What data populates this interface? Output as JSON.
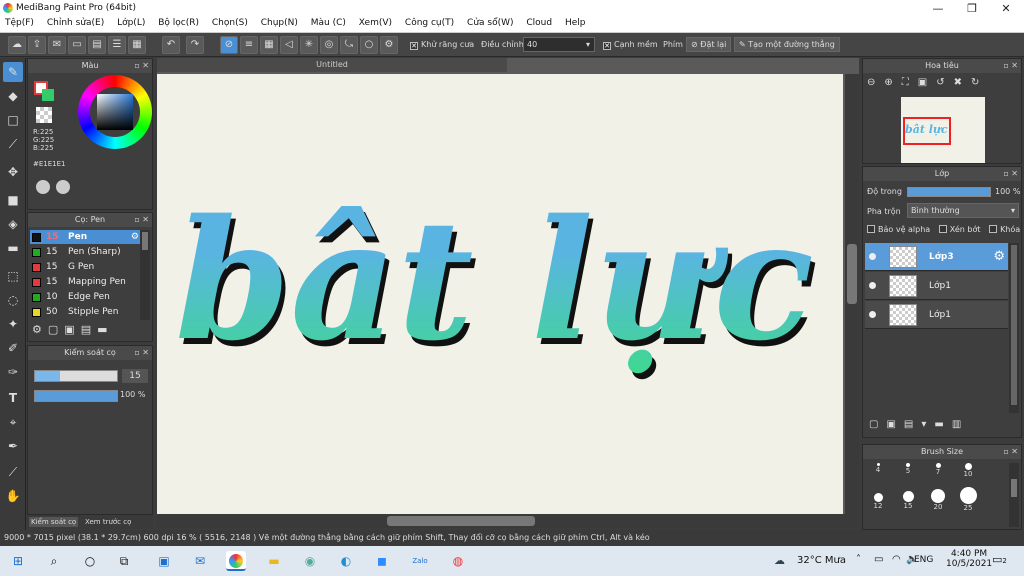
{
  "window": {
    "title": "MediBang Paint Pro (64bit)",
    "min": "—",
    "max": "❐",
    "close": "✕"
  },
  "menu": [
    "Tệp(F)",
    "Chỉnh sửa(E)",
    "Lớp(L)",
    "Bộ lọc(R)",
    "Chọn(S)",
    "Chụp(N)",
    "Màu (C)",
    "Xem(V)",
    "Công cụ(T)",
    "Cửa sổ(W)",
    "Cloud",
    "Help"
  ],
  "toolbar": {
    "antialias_label": "Khử răng cưa",
    "adjust_label": "Điều chỉnh",
    "adjust_value": "40",
    "edge_label": "Cạnh mềm",
    "key_label": "Phím",
    "reset_label": "Đặt lại",
    "straight_line_label": "Tạo một đường thẳng"
  },
  "color_panel": {
    "title": "Màu",
    "r": "R:225",
    "g": "G:225",
    "b": "B:225",
    "hex": "#E1E1E1",
    "fg_color": "#e1e1e1",
    "bg_color": "#e33b3b"
  },
  "brush_panel": {
    "title": "Cọ: Pen",
    "brushes": [
      {
        "size": "15",
        "name": "Pen",
        "color": "#111111"
      },
      {
        "size": "15",
        "name": "Pen (Sharp)",
        "color": "#22aa22"
      },
      {
        "size": "15",
        "name": "G Pen",
        "color": "#e33b3b"
      },
      {
        "size": "15",
        "name": "Mapping Pen",
        "color": "#e33b3b"
      },
      {
        "size": "10",
        "name": "Edge Pen",
        "color": "#22aa22"
      },
      {
        "size": "50",
        "name": "Stipple Pen",
        "color": "#e8d820"
      }
    ]
  },
  "brush_control": {
    "title": "Kiểm soát cọ",
    "size": "15",
    "opacity": "100 %",
    "size_fill": 0.3,
    "opacity_fill": 1.0
  },
  "left_tabs": {
    "control": "Kiểm soát cọ",
    "preview": "Xem trước cọ"
  },
  "canvas": {
    "tab": "Untitled",
    "text": "bât lực"
  },
  "navigator": {
    "title": "Hoa tiêu"
  },
  "layers": {
    "title": "Lớp",
    "opacity_label": "Độ trong",
    "opacity_value": "100 %",
    "blend_label": "Pha trộn",
    "blend_value": "Bình thường",
    "protect_alpha": "Bảo vệ alpha",
    "clip": "Xén bớt",
    "lock": "Khóa",
    "items": [
      {
        "name": "Lớp3",
        "selected": true
      },
      {
        "name": "Lớp1",
        "selected": false
      },
      {
        "name": "Lớp1",
        "selected": false
      }
    ]
  },
  "brush_size": {
    "title": "Brush Size",
    "sizes": [
      "4",
      "5",
      "7",
      "10",
      "12",
      "15",
      "20",
      "25"
    ]
  },
  "status": {
    "text": "9000 * 7015 pixel  (38.1 * 29.7cm)  600 dpi  16 %  ( 5516, 2148 )  Vẽ một đường thẳng bằng cách giữ phím Shift, Thay đổi cỡ cọ bằng cách giữ phím Ctrl, Alt và kéo"
  },
  "taskbar": {
    "weather": "32°C Mưa",
    "lang": "ENG",
    "time": "4:40 PM",
    "date": "10/5/2021",
    "notif": "2"
  }
}
